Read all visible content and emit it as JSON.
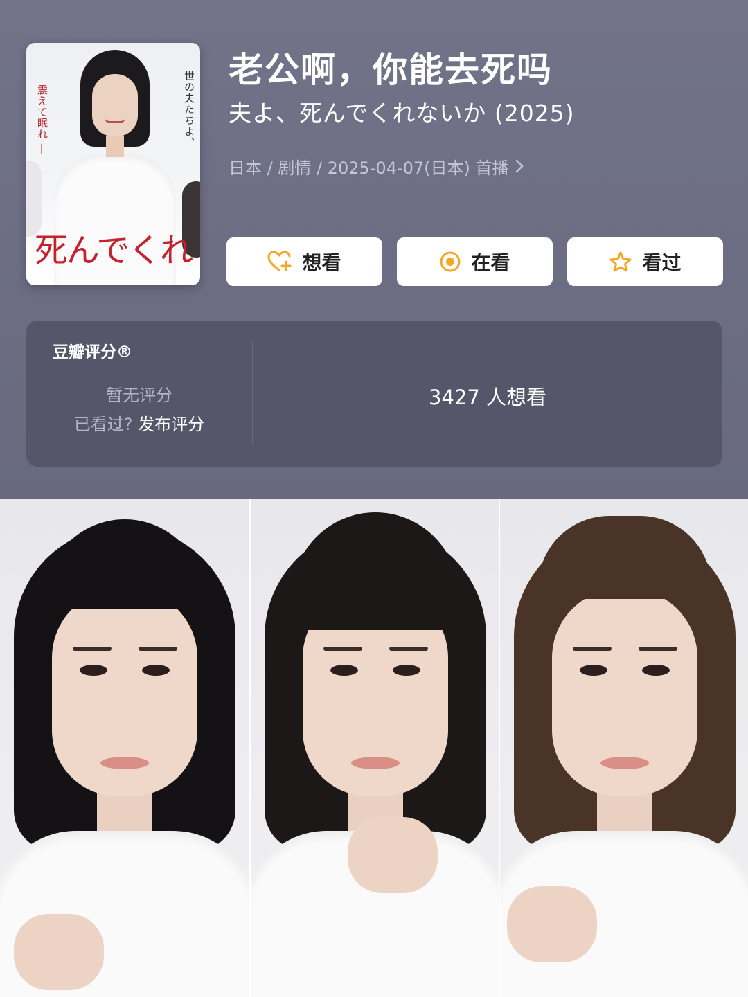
{
  "poster": {
    "vertical_text_1": "世の夫たちよ、",
    "vertical_text_2": "震えて眠れ ―",
    "big_text": "死んでくれ"
  },
  "title": "老公啊，你能去死吗",
  "subtitle": "夫よ、死んでくれないか (2025)",
  "meta": "日本 / 剧情 / 2025-04-07(日本) 首播",
  "buttons": {
    "want": "想看",
    "doing": "在看",
    "done": "看过"
  },
  "rating": {
    "label": "豆瓣评分®",
    "none": "暂无评分",
    "seen_prefix": "已看过?",
    "post": "发布评分",
    "count": "3427 人想看"
  },
  "colors": {
    "header_bg": "#6e6f86",
    "panel_bg": "#55566a",
    "icon_orange": "#f5a623",
    "poster_red": "#c4232c"
  },
  "icons": {
    "want": "heart-plus-icon",
    "doing": "target-circle-icon",
    "done": "star-icon",
    "meta": "chevron-right-icon"
  }
}
